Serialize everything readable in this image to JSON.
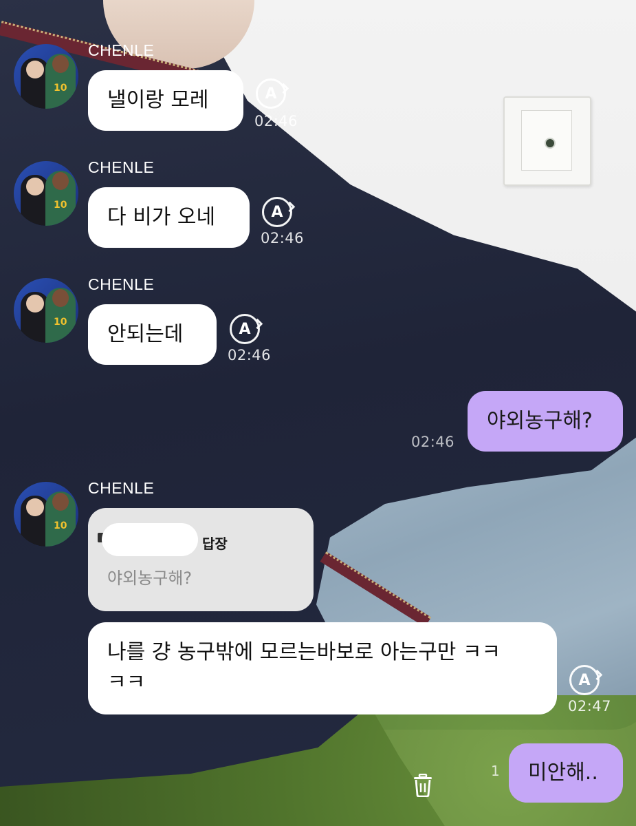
{
  "sender_name": "CHENLE",
  "translate_icon_glyph": "A",
  "messages": [
    {
      "text": "낼이랑 모레",
      "time": "02:46"
    },
    {
      "text": "다 비가 오네",
      "time": "02:46"
    },
    {
      "text": "안되는데",
      "time": "02:46"
    },
    {
      "text": "야외농구해?",
      "time": "02:46"
    },
    {
      "reply_label": "답장",
      "reply_quote": "야외농구해?",
      "text_line1": "나를 걍 농구밖에 모르는바보로 아는구만 ㅋㅋ",
      "text_line2": "ㅋㅋ",
      "time": "02:47"
    },
    {
      "text": "미안해..",
      "unread_count": "1"
    }
  ],
  "colors": {
    "incoming_bubble": "#ffffff",
    "outgoing_bubble": "#c5a7f7",
    "reply_box": "#e5e5e5",
    "meta_text": "#ffffff"
  },
  "icons": [
    "avatar-photo",
    "auto-translate-icon",
    "trash-icon"
  ]
}
